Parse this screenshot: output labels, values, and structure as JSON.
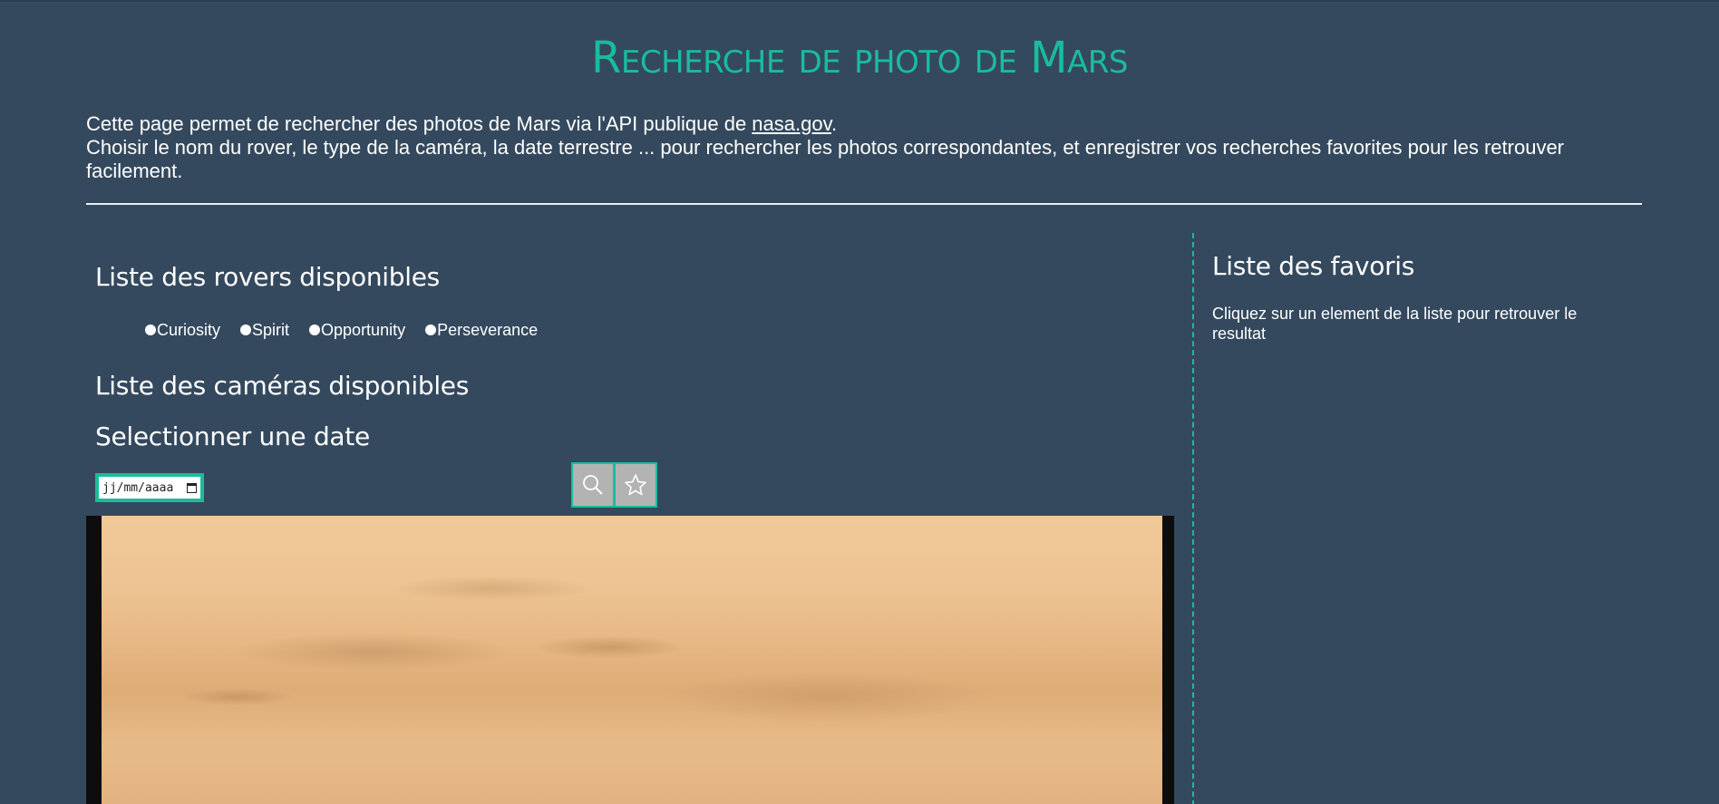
{
  "header": {
    "title": "Recherche de photo de Mars",
    "intro_line1_before": "Cette page permet de rechercher des photos de Mars via l'API publique de ",
    "intro_link": "nasa.gov",
    "intro_line1_after": ".",
    "intro_line2": "Choisir le nom du rover, le type de la caméra, la date terrestre ... pour rechercher les photos correspondantes, et enregistrer vos recherches favorites pour les retrouver facilement."
  },
  "rovers": {
    "heading": "Liste des rovers disponibles",
    "items": [
      "Curiosity",
      "Spirit",
      "Opportunity",
      "Perseverance"
    ]
  },
  "cameras": {
    "heading": "Liste des caméras disponibles"
  },
  "date": {
    "heading": "Selectionner une date",
    "placeholder": "jj/mm/aaaa"
  },
  "actions": {
    "search_icon": "search-icon",
    "favorite_icon": "star-icon"
  },
  "favorites": {
    "heading": "Liste des favoris",
    "description": "Cliquez sur un element de la liste pour retrouver le resultat"
  },
  "colors": {
    "background": "#34495e",
    "accent": "#1abc9c",
    "text": "#ffffff",
    "button_bg": "#b3b3b3"
  }
}
